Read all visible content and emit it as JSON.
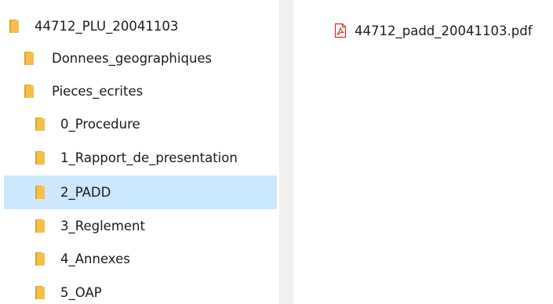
{
  "navigation_pane": {
    "items": [
      {
        "label": "44712_PLU_20041103",
        "icon": "folder-icon",
        "selected": false
      },
      {
        "label": "Donnees_geographiques",
        "icon": "folder-icon",
        "selected": false
      },
      {
        "label": "Pieces_ecrites",
        "icon": "folder-icon",
        "selected": false
      },
      {
        "label": "0_Procedure",
        "icon": "folder-icon",
        "selected": false
      },
      {
        "label": "1_Rapport_de_presentation",
        "icon": "folder-icon",
        "selected": false
      },
      {
        "label": "2_PADD",
        "icon": "folder-icon",
        "selected": true
      },
      {
        "label": "3_Reglement",
        "icon": "folder-icon",
        "selected": false
      },
      {
        "label": "4_Annexes",
        "icon": "folder-icon",
        "selected": false
      },
      {
        "label": "5_OAP",
        "icon": "folder-icon",
        "selected": false
      }
    ]
  },
  "content_pane": {
    "files": [
      {
        "label": "44712_padd_20041103.pdf",
        "icon": "pdf-file-icon"
      }
    ]
  },
  "colors": {
    "folder": "#f5c04a",
    "folder_dark": "#e0a526",
    "selection": "#cce8ff",
    "pdf_red": "#d9302a",
    "splitter": "#f0f0f0"
  }
}
